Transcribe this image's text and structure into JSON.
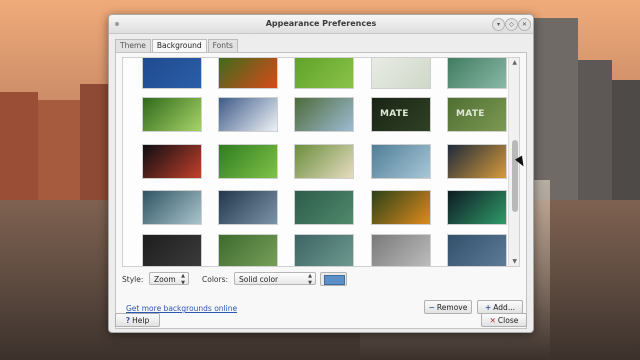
{
  "window": {
    "title": "Appearance Preferences"
  },
  "tabs": [
    {
      "label": "Theme",
      "active": false
    },
    {
      "label": "Background",
      "active": true
    },
    {
      "label": "Fonts",
      "active": false
    }
  ],
  "gallery": {
    "thumbnails": [
      {
        "name": "blue-texture",
        "colors": [
          "#1f4a8e",
          "#2b5ea8"
        ]
      },
      {
        "name": "red-flower",
        "colors": [
          "#3a6c1c",
          "#d84a1a"
        ]
      },
      {
        "name": "green-grass",
        "colors": [
          "#5ea127",
          "#8bc34a"
        ]
      },
      {
        "name": "mate-light-logo",
        "colors": [
          "#e9ece6",
          "#cfd8c8"
        ]
      },
      {
        "name": "green-gradient",
        "colors": [
          "#3c7a5d",
          "#8bb8a8"
        ]
      },
      {
        "name": "green-leaf-light",
        "colors": [
          "#2f6a1a",
          "#a8d36a"
        ]
      },
      {
        "name": "snowy-mountains",
        "colors": [
          "#3f5b88",
          "#eef2f6"
        ]
      },
      {
        "name": "mountain-lake",
        "colors": [
          "#4e6b3c",
          "#9dbbd2"
        ]
      },
      {
        "name": "mate-dark",
        "colors": [
          "#1a2414",
          "#2f4126"
        ],
        "text": "MATE"
      },
      {
        "name": "mate-green",
        "colors": [
          "#506e32",
          "#7c9a52"
        ],
        "text": "MATE"
      },
      {
        "name": "bokeh-lights",
        "colors": [
          "#0d0d12",
          "#c3402b"
        ]
      },
      {
        "name": "green-leaf-dew",
        "colors": [
          "#2e7d1e",
          "#80c24a"
        ]
      },
      {
        "name": "tropical-beach",
        "colors": [
          "#6a8e3c",
          "#e6dcc0"
        ]
      },
      {
        "name": "blue-waves",
        "colors": [
          "#4f7e98",
          "#a9c7d6"
        ]
      },
      {
        "name": "sunset-landscape",
        "colors": [
          "#1e2a3a",
          "#d79b3c"
        ]
      },
      {
        "name": "teal-wave",
        "colors": [
          "#2f5564",
          "#aac4cc"
        ]
      },
      {
        "name": "stormy-sky",
        "colors": [
          "#23384c",
          "#7b93a8"
        ]
      },
      {
        "name": "green-stripes",
        "colors": [
          "#2e5c4c",
          "#4f8a6b"
        ]
      },
      {
        "name": "orange-bokeh",
        "colors": [
          "#2b4219",
          "#e08a1c"
        ]
      },
      {
        "name": "aurora",
        "colors": [
          "#0e1a22",
          "#2f9b6a"
        ]
      },
      {
        "name": "partial-dark",
        "colors": [
          "#1d1d1d",
          "#3c3c3c"
        ]
      },
      {
        "name": "partial-green",
        "colors": [
          "#3d6a2e",
          "#78a05a"
        ]
      },
      {
        "name": "partial-teal",
        "colors": [
          "#3d6464",
          "#6e9a90"
        ]
      },
      {
        "name": "partial-gray",
        "colors": [
          "#7a7a7a",
          "#bdbdbd"
        ]
      },
      {
        "name": "partial-blue",
        "colors": [
          "#32506a",
          "#5e7c98"
        ]
      }
    ]
  },
  "options": {
    "style_label": "Style:",
    "style_value": "Zoom",
    "colors_label": "Colors:",
    "colors_value": "Solid color",
    "color_swatch": "#5a8fc7"
  },
  "actions": {
    "more_link": "Get more backgrounds online",
    "remove_label": "Remove",
    "add_label": "Add...",
    "help_label": "Help",
    "close_label": "Close"
  }
}
